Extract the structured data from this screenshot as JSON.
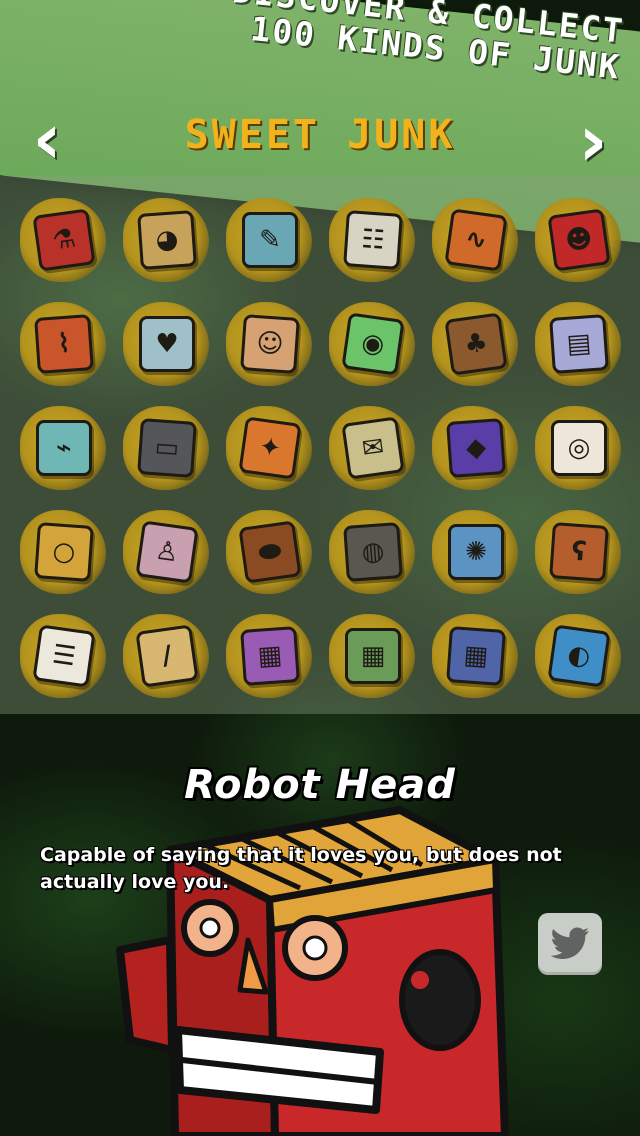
{
  "promo": {
    "line1": "DISCOVER & COLLECT",
    "line2": "100 KINDS OF JUNK"
  },
  "nav": {
    "prev_icon": "chevron-left-icon",
    "next_icon": "chevron-right-icon"
  },
  "category": {
    "title": "SWEET JUNK"
  },
  "grid": {
    "items": [
      {
        "icon": "science-book-icon",
        "color": "#b8322a",
        "glyph": "⚗"
      },
      {
        "icon": "muffin-card-icon",
        "color": "#c7a25a",
        "glyph": "◕"
      },
      {
        "icon": "act-card-icon",
        "color": "#6aa7b5",
        "glyph": "✎"
      },
      {
        "icon": "magazine-icon",
        "color": "#d8d4c4",
        "glyph": "☷"
      },
      {
        "icon": "robot-arm-icon",
        "color": "#d06a2a",
        "glyph": "∿"
      },
      {
        "icon": "robot-head-icon",
        "color": "#c0282a",
        "glyph": "☻"
      },
      {
        "icon": "robot-leg-icon",
        "color": "#c9552a",
        "glyph": "⌇"
      },
      {
        "icon": "anatomical-heart-icon",
        "color": "#9fc0c8",
        "glyph": "♥"
      },
      {
        "icon": "human-face-icon",
        "color": "#d6a274",
        "glyph": "☺"
      },
      {
        "icon": "alien-head-icon",
        "color": "#6cc46a",
        "glyph": "◉"
      },
      {
        "icon": "bigfoot-icon",
        "color": "#8a5a2e",
        "glyph": "♣"
      },
      {
        "icon": "old-phone-icon",
        "color": "#a7a9d6",
        "glyph": "▤"
      },
      {
        "icon": "cracked-screen-icon",
        "color": "#6fb7b4",
        "glyph": "⌁"
      },
      {
        "icon": "usb-stick-icon",
        "color": "#54565a",
        "glyph": "▭"
      },
      {
        "icon": "toy-gun-icon",
        "color": "#d9772e",
        "glyph": "✦"
      },
      {
        "icon": "treasure-map-icon",
        "color": "#c9bf8a",
        "glyph": "✉"
      },
      {
        "icon": "purple-gem-icon",
        "color": "#5a3ea8",
        "glyph": "◆"
      },
      {
        "icon": "eyeball-icon",
        "color": "#eee6d8",
        "glyph": "◎"
      },
      {
        "icon": "gold-ring-icon",
        "color": "#d2a43a",
        "glyph": "○"
      },
      {
        "icon": "lamp-icon",
        "color": "#c8a0b0",
        "glyph": "♙"
      },
      {
        "icon": "coffin-icon",
        "color": "#8a4a22",
        "glyph": "⬬"
      },
      {
        "icon": "frying-pan-icon",
        "color": "#5a5650",
        "glyph": "◍"
      },
      {
        "icon": "splat-icon",
        "color": "#5b93c2",
        "glyph": "✺"
      },
      {
        "icon": "teddy-bear-icon",
        "color": "#b45e2e",
        "glyph": "ʕ"
      },
      {
        "icon": "note-card-icon",
        "color": "#ece8dc",
        "glyph": "☰"
      },
      {
        "icon": "stick-icon",
        "color": "#d8b870",
        "glyph": "/"
      },
      {
        "icon": "purple-notebook-icon",
        "color": "#9a5bb4",
        "glyph": "▦"
      },
      {
        "icon": "green-notebook-icon",
        "color": "#6a9c58",
        "glyph": "▦"
      },
      {
        "icon": "blue-notebook-icon",
        "color": "#5064a8",
        "glyph": "▦"
      },
      {
        "icon": "earth-core-icon",
        "color": "#3f8ec7",
        "glyph": "◐"
      }
    ]
  },
  "detail": {
    "title": "Robot Head",
    "description": "Capable of saying that it loves you, but does not actually love you.",
    "share_icon": "twitter-bird-icon"
  },
  "colors": {
    "banner": "#7fb36a",
    "category_title": "#f2b21c",
    "robot_red": "#c8282a",
    "robot_gold": "#e0a438"
  }
}
